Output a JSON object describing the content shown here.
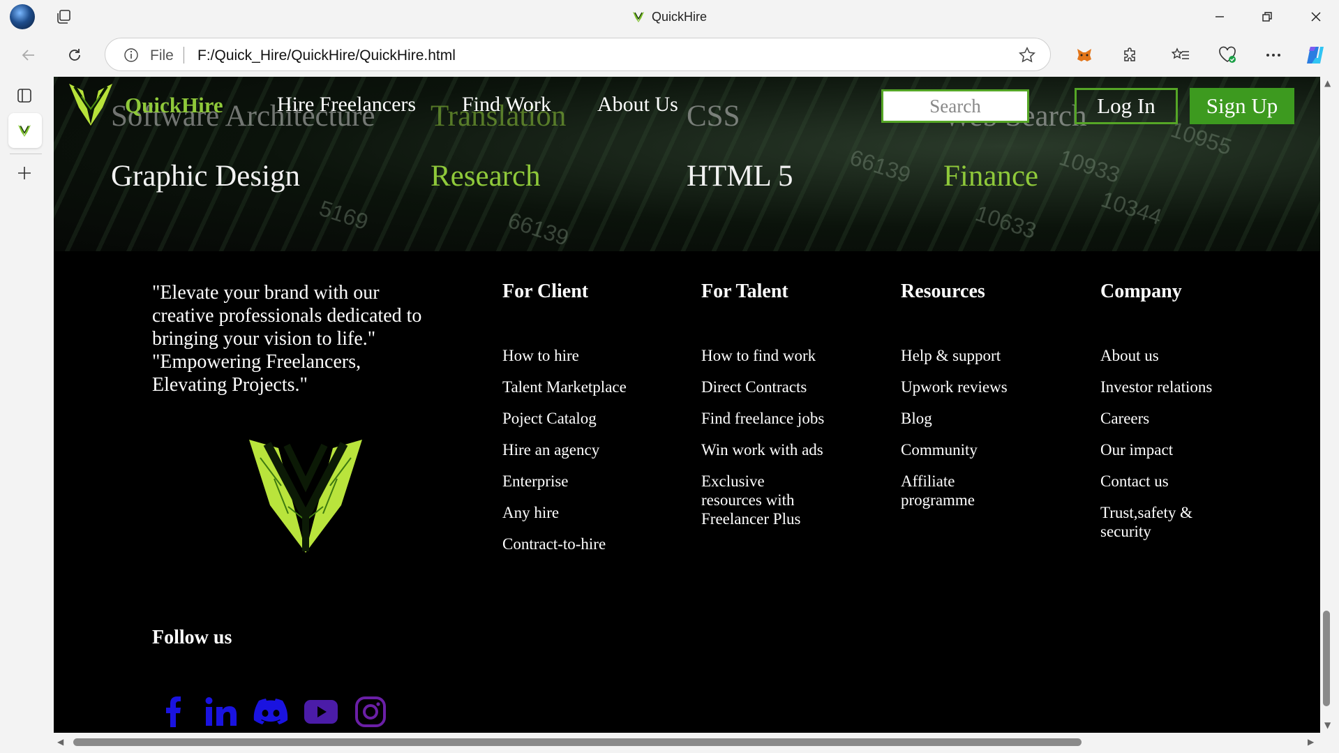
{
  "browser": {
    "tab_title": "QuickHire",
    "address": {
      "scheme_label": "File",
      "url": "F:/Quick_Hire/QuickHire/QuickHire.html"
    }
  },
  "site": {
    "brand": "QuickHire",
    "nav_links": [
      "Hire Freelancers",
      "Find Work",
      "About Us"
    ],
    "search_placeholder": "Search",
    "login_label": "Log In",
    "signup_label": "Sign Up",
    "accent_color": "#8fc93a",
    "button_green": "#3d9a1f"
  },
  "categories": {
    "row1_partial": [
      "Software Architecture",
      "Translation",
      "CSS",
      "Web Search"
    ],
    "row2": [
      "Graphic Design",
      "Research",
      "HTML 5",
      "Finance"
    ]
  },
  "footer": {
    "quote": "\"Elevate your brand with our creative professionals dedicated to bringing your vision to life.\" \"Empowering Freelancers, Elevating Projects.\"",
    "columns": [
      {
        "title": "For Client",
        "items": [
          "How to hire",
          "Talent Marketplace",
          "Poject Catalog",
          "Hire an agency",
          "Enterprise",
          "Any hire",
          "Contract-to-hire"
        ]
      },
      {
        "title": "For Talent",
        "items": [
          "How to find work",
          "Direct Contracts",
          "Find freelance jobs",
          "Win work with ads",
          "Exclusive resources with Freelancer Plus"
        ]
      },
      {
        "title": "Resources",
        "items": [
          "Help & support",
          "Upwork reviews",
          "Blog",
          "Community",
          "Affiliate programme"
        ]
      },
      {
        "title": "Company",
        "items": [
          "About us",
          "Investor relations",
          "Careers",
          "Our impact",
          "Contact us",
          "Trust,safety & security"
        ]
      }
    ],
    "follow_label": "Follow us",
    "social_icons": [
      "facebook-icon",
      "linkedin-icon",
      "discord-icon",
      "youtube-icon",
      "instagram-icon"
    ]
  }
}
